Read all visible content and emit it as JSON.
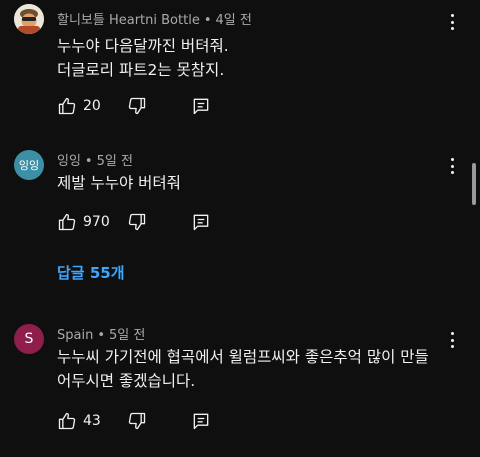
{
  "comments": [
    {
      "author": "할니보틀 Heartni Bottle",
      "time": "4일 전",
      "lines": [
        "누누야 다음달까진 버텨줘.",
        "더글로리 파트2는 못참지."
      ],
      "likes": "20",
      "avatar_icon": "cartoon-avatar"
    },
    {
      "author": "잉잉",
      "time": "5일 전",
      "lines": [
        "제발 누누야 버텨줘"
      ],
      "likes": "970",
      "avatar_text": "잉잉",
      "avatar_color": "#3d8fa6"
    },
    {
      "author": "Spain",
      "time": "5일 전",
      "lines": [
        "누누씨 가기전에 협곡에서 윌럼프씨와 좋은추억 많이 만들",
        "어두시면 좋겠습니다."
      ],
      "likes": "43",
      "avatar_text": "S",
      "avatar_color": "#8e1e4b"
    }
  ],
  "replies_link": "답글 55개",
  "separator": "•",
  "colors": {
    "background": "#0f0f0f",
    "text": "#f1f1f1",
    "meta": "#aaaaaa",
    "link": "#3ea6ff"
  },
  "icons": [
    "thumb-up-icon",
    "thumb-down-icon",
    "reply-icon",
    "more-vert-icon"
  ]
}
